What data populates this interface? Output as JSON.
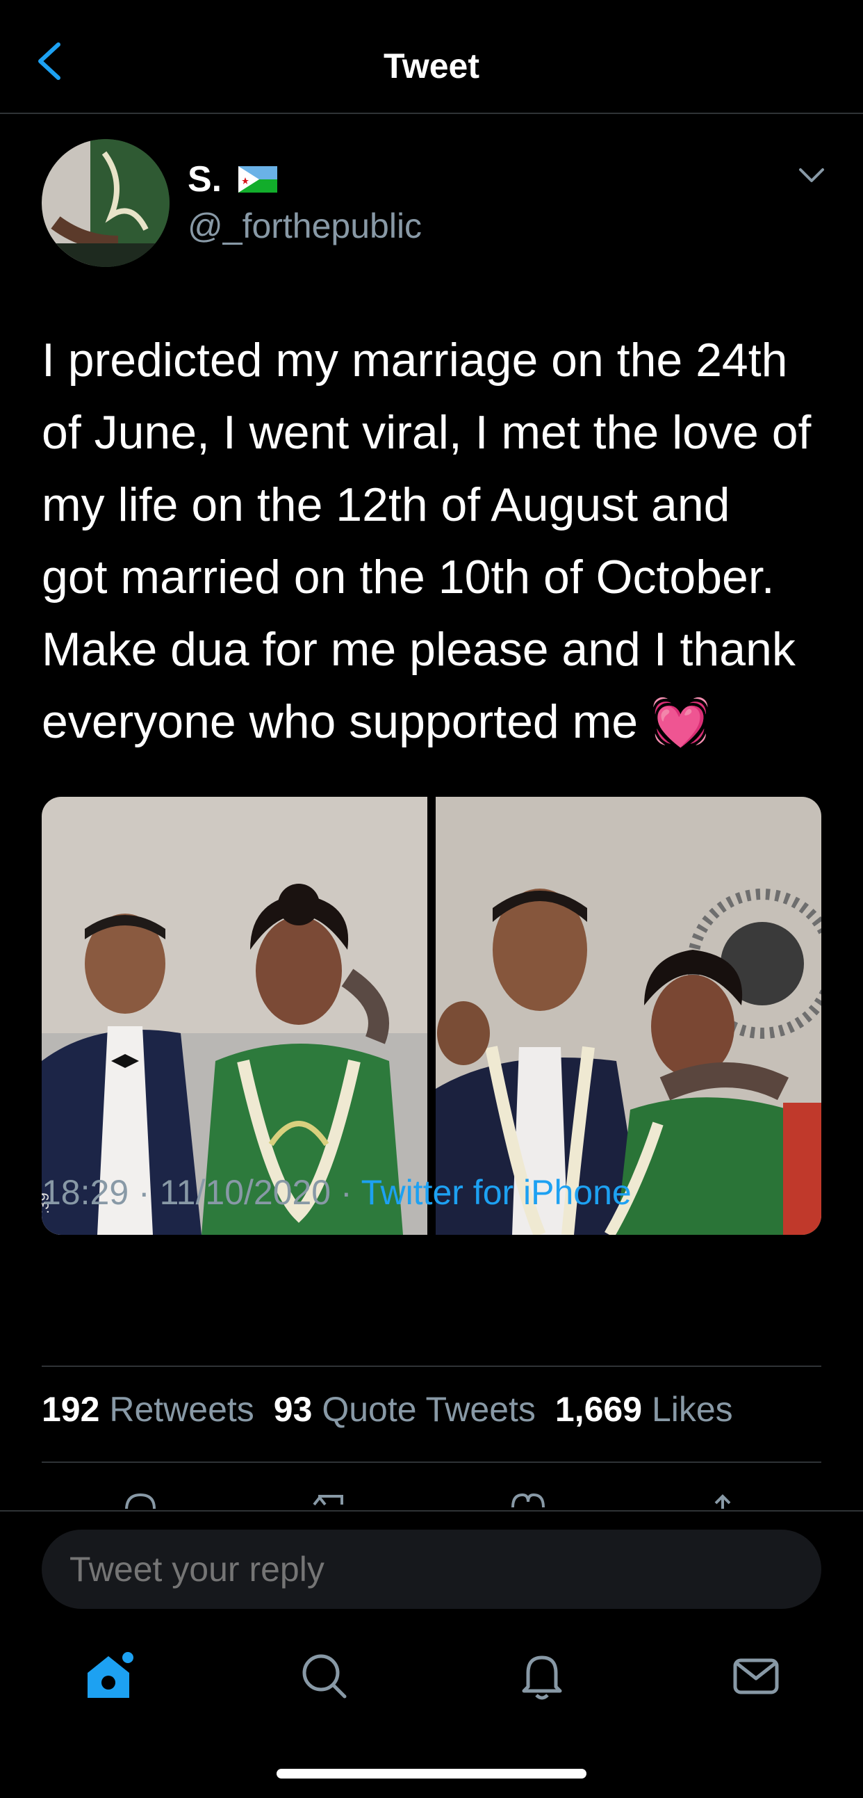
{
  "header": {
    "title": "Tweet",
    "back_icon": "chevron-left-icon"
  },
  "author": {
    "name": "S.",
    "flag": "djibouti-flag",
    "handle": "@_forthepublic"
  },
  "tweet": {
    "text": "I predicted my marriage on the 24th\nof June, I went viral, I met the love of\nmy life on the 12th of August and\ngot married on the 10th of October.\nMake dua for me please and I thank\neveryone who supported me 💓",
    "time": "18:29",
    "date": "11/10/2020",
    "source": "Twitter for iPhone",
    "photo_overlay_text": ":39"
  },
  "stats": {
    "retweets_count": "192",
    "retweets_label": "Retweets",
    "quotes_count": "93",
    "quotes_label": "Quote Tweets",
    "likes_count": "1,669",
    "likes_label": "Likes"
  },
  "reply": {
    "placeholder": "Tweet your reply"
  },
  "colors": {
    "accent": "#1da1f2",
    "secondary_text": "#8899a6",
    "divider": "#2f3336",
    "background": "#000000"
  },
  "tabbar": {
    "items": [
      "home-icon",
      "search-icon",
      "notifications-icon",
      "messages-icon"
    ]
  }
}
